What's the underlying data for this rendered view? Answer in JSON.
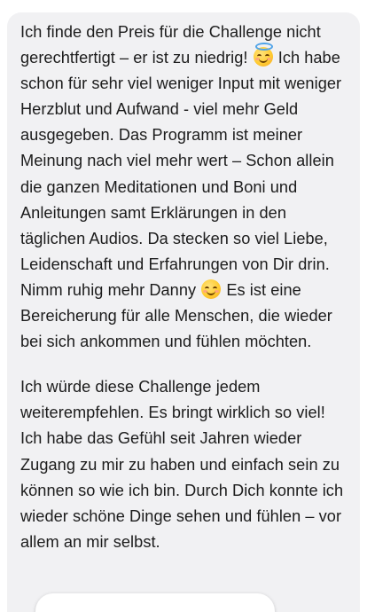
{
  "message": {
    "p1": {
      "a": "Ich finde den Preis für die Challenge nicht gerechtfertigt – er ist zu niedrig! ",
      "b": " Ich habe schon für sehr viel weniger Input mit weniger Herzblut und Aufwand - viel mehr Geld ausgegeben. Das Programm ist meiner Meinung nach viel mehr wert – Schon allein die ganzen Meditationen und Boni und Anleitungen samt Erklärungen in den täglichen Audios. Da stecken so viel Liebe, Leidenschaft und Erfahrungen von Dir drin. Nimm ruhig mehr Danny ",
      "c": " Es ist eine Bereicherung für alle Menschen, die wieder bei sich ankommen und fühlen möchten."
    },
    "p2": "Ich würde diese Challenge jedem weiterempfehlen. Es bringt wirklich so viel! Ich habe das Gefühl seit Jahren wieder Zugang zu mir zu haben und einfach sein zu können so wie ich bin. Durch Dich konnte ich wieder schöne Dinge sehen und fühlen – vor allem an mir selbst.",
    "emojis": [
      "smiling-face-with-halo",
      "smiling-face-with-smiling-eyes"
    ]
  },
  "colors": {
    "bubble_bg": "#f1f1f3",
    "text": "#1c1c1c",
    "page_bg": "#ffffff"
  }
}
